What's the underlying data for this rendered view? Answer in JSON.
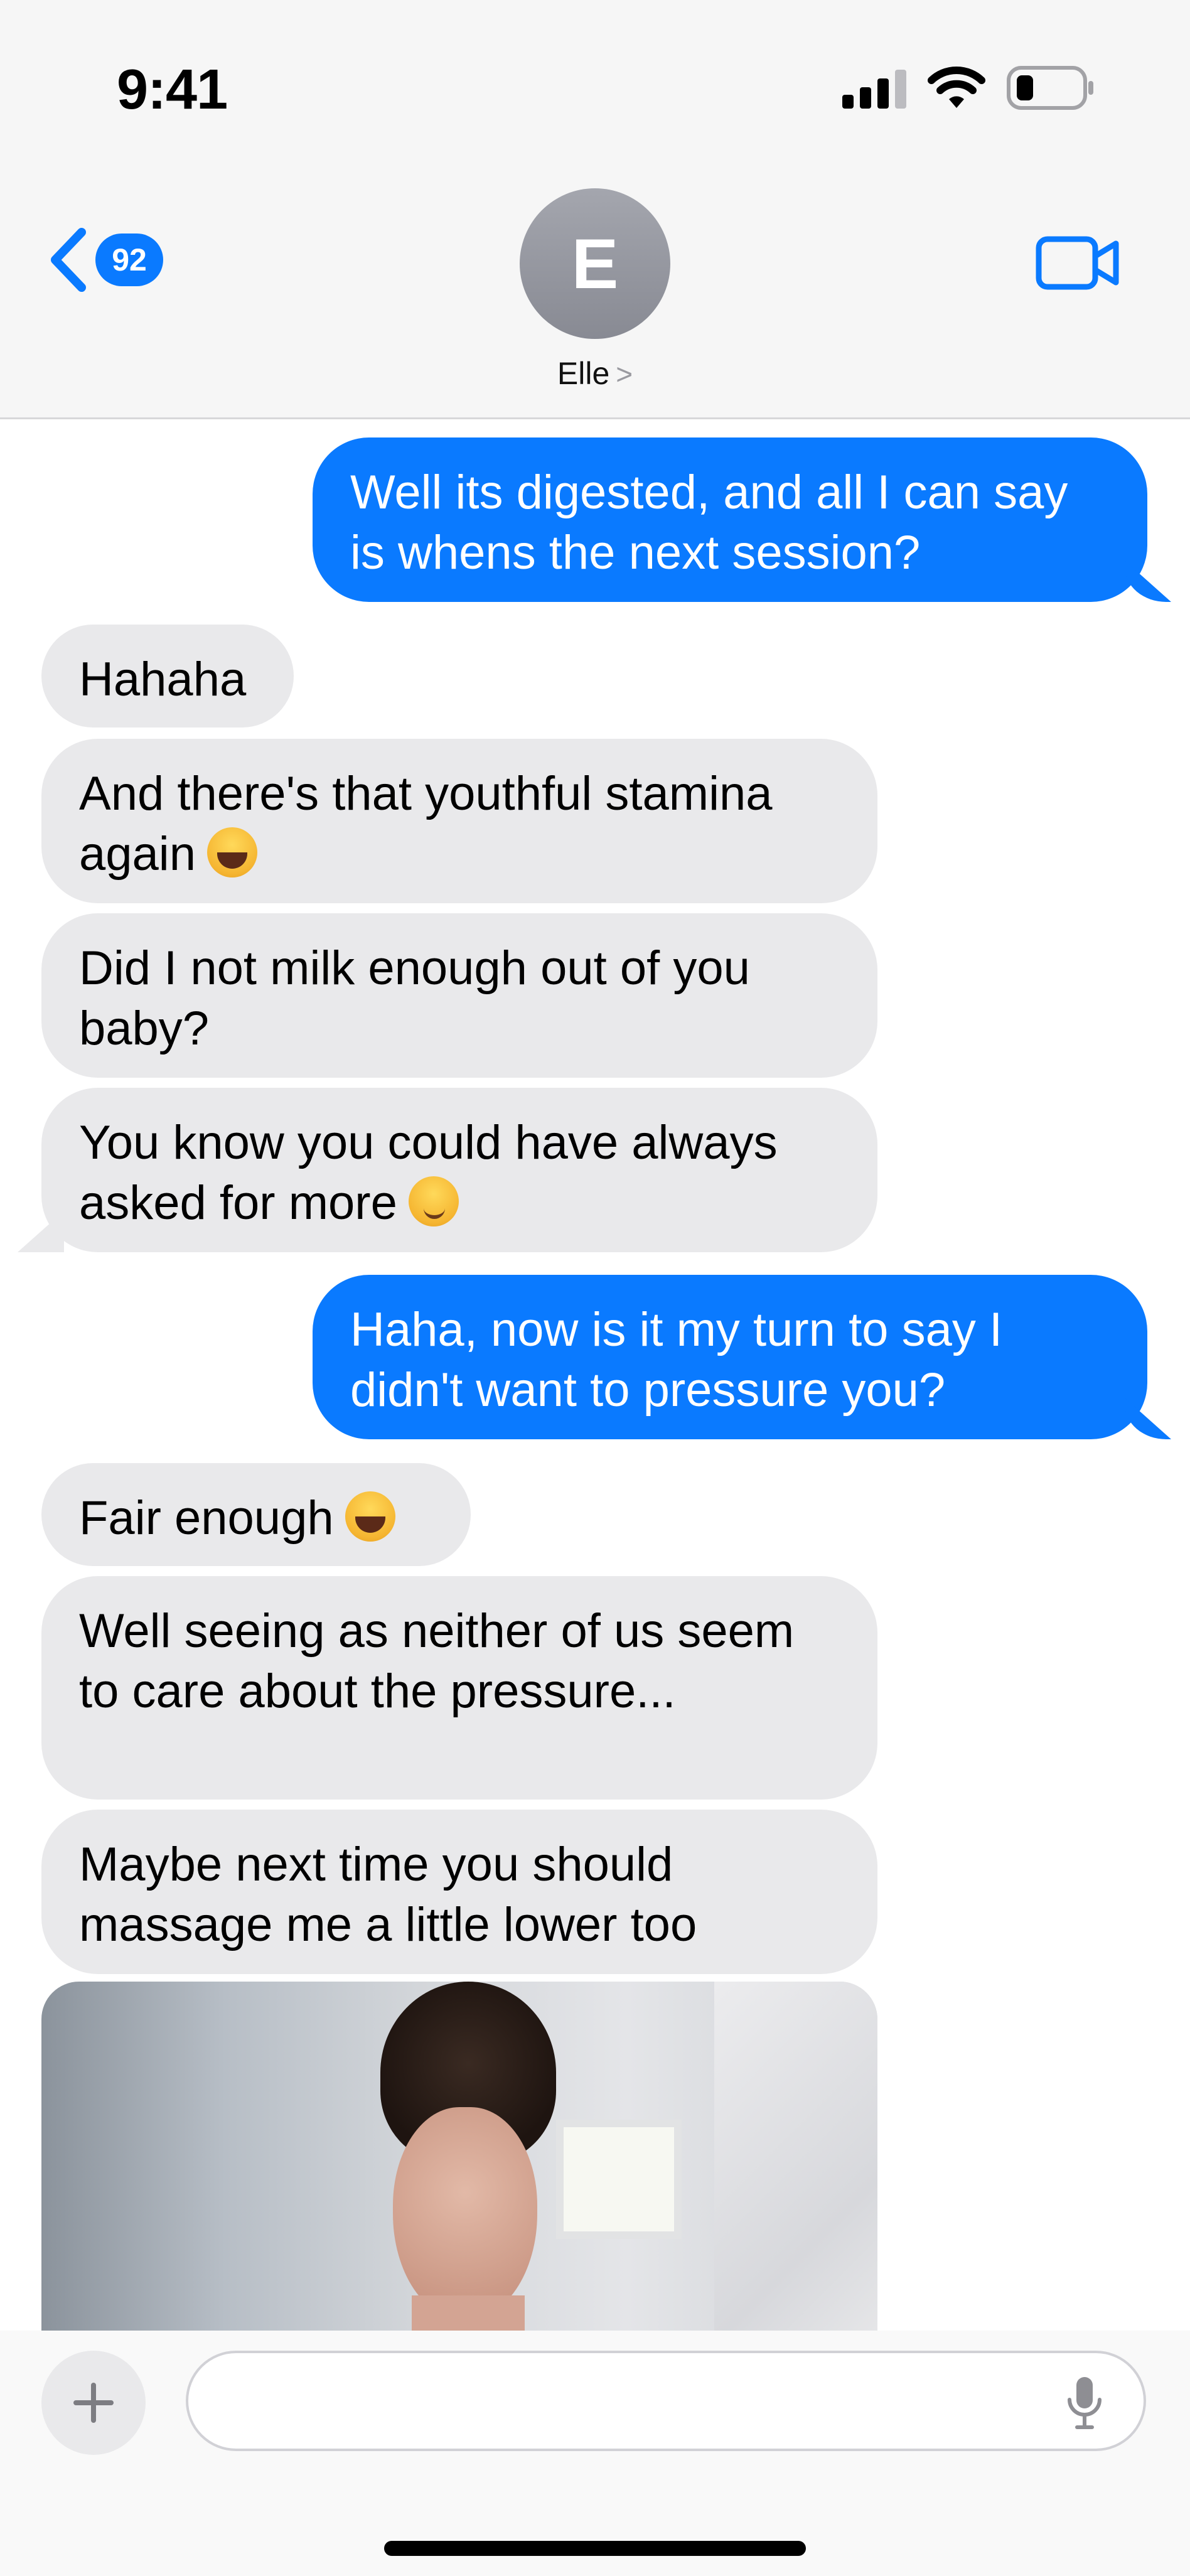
{
  "status_bar": {
    "time": "9:41",
    "icons": [
      "signal-icon",
      "wifi-icon",
      "battery-icon"
    ]
  },
  "header": {
    "back_badge": "92",
    "avatar_initial": "E",
    "contact_name": "Elle",
    "contact_chevron": ">",
    "icons": [
      "back-chevron-icon",
      "facetime-video-icon"
    ]
  },
  "messages": [
    {
      "from": "me",
      "text": "Well its digested, and all I can say is whens the next session?"
    },
    {
      "from": "them",
      "text": "Hahaha"
    },
    {
      "from": "them",
      "text": "And there's that youthful stamina again",
      "emoji": "laughing-face"
    },
    {
      "from": "them",
      "text": "Did I not milk enough out of you baby?"
    },
    {
      "from": "them",
      "text": "You know you could have always asked for more",
      "emoji": "smirking-face"
    },
    {
      "from": "me",
      "text": "Haha, now is it my turn to say I didn't want to pressure you?"
    },
    {
      "from": "them",
      "text": "Fair enough",
      "emoji": "laughing-face"
    },
    {
      "from": "them",
      "text": "Well seeing as neither of us seem to care about the pressure..."
    },
    {
      "from": "them",
      "text": "Maybe next time you should massage me a little lower too"
    },
    {
      "from": "them",
      "type": "photo"
    }
  ],
  "compose": {
    "icons": [
      "plus-icon",
      "microphone-icon"
    ]
  },
  "colors": {
    "outgoing_bubble": "#0a7aff",
    "incoming_bubble": "#e9e9eb",
    "badge": "#0a7aff"
  }
}
